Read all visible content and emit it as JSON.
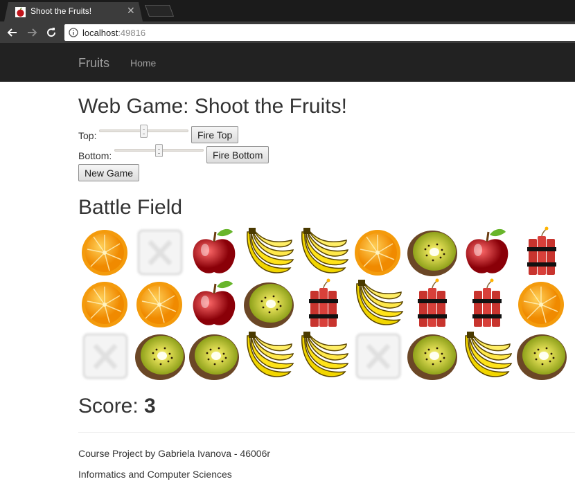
{
  "browser": {
    "tab_title": "Shoot the Fruits!",
    "url_host": "localhost",
    "url_port": ":49816"
  },
  "navbar": {
    "brand": "Fruits",
    "links": [
      "Home"
    ]
  },
  "page": {
    "title": "Web Game: Shoot the Fruits!",
    "top_label": "Top:",
    "top_slider_value": 0.5,
    "fire_top": "Fire Top",
    "bottom_label": "Bottom:",
    "bottom_slider_value": 0.5,
    "fire_bottom": "Fire Bottom",
    "new_game": "New Game",
    "battlefield_title": "Battle Field",
    "score_label": "Score: ",
    "score_value": "3"
  },
  "battlefield": [
    [
      "orange",
      "empty",
      "apple",
      "banana",
      "banana",
      "orange",
      "kiwi",
      "apple",
      "dynamite"
    ],
    [
      "orange",
      "orange",
      "apple",
      "kiwi",
      "dynamite",
      "banana",
      "dynamite",
      "dynamite",
      "orange"
    ],
    [
      "empty",
      "kiwi",
      "kiwi",
      "banana",
      "banana",
      "empty",
      "kiwi",
      "banana",
      "kiwi"
    ]
  ],
  "footer": {
    "line1": "Course Project by Gabriela Ivanova - 46006r",
    "line2": "Informatics and Computer Sciences"
  },
  "colors": {
    "navbar_bg": "#222222",
    "navbar_text": "#9d9d9d",
    "chrome_bg": "#3c3c3c"
  }
}
